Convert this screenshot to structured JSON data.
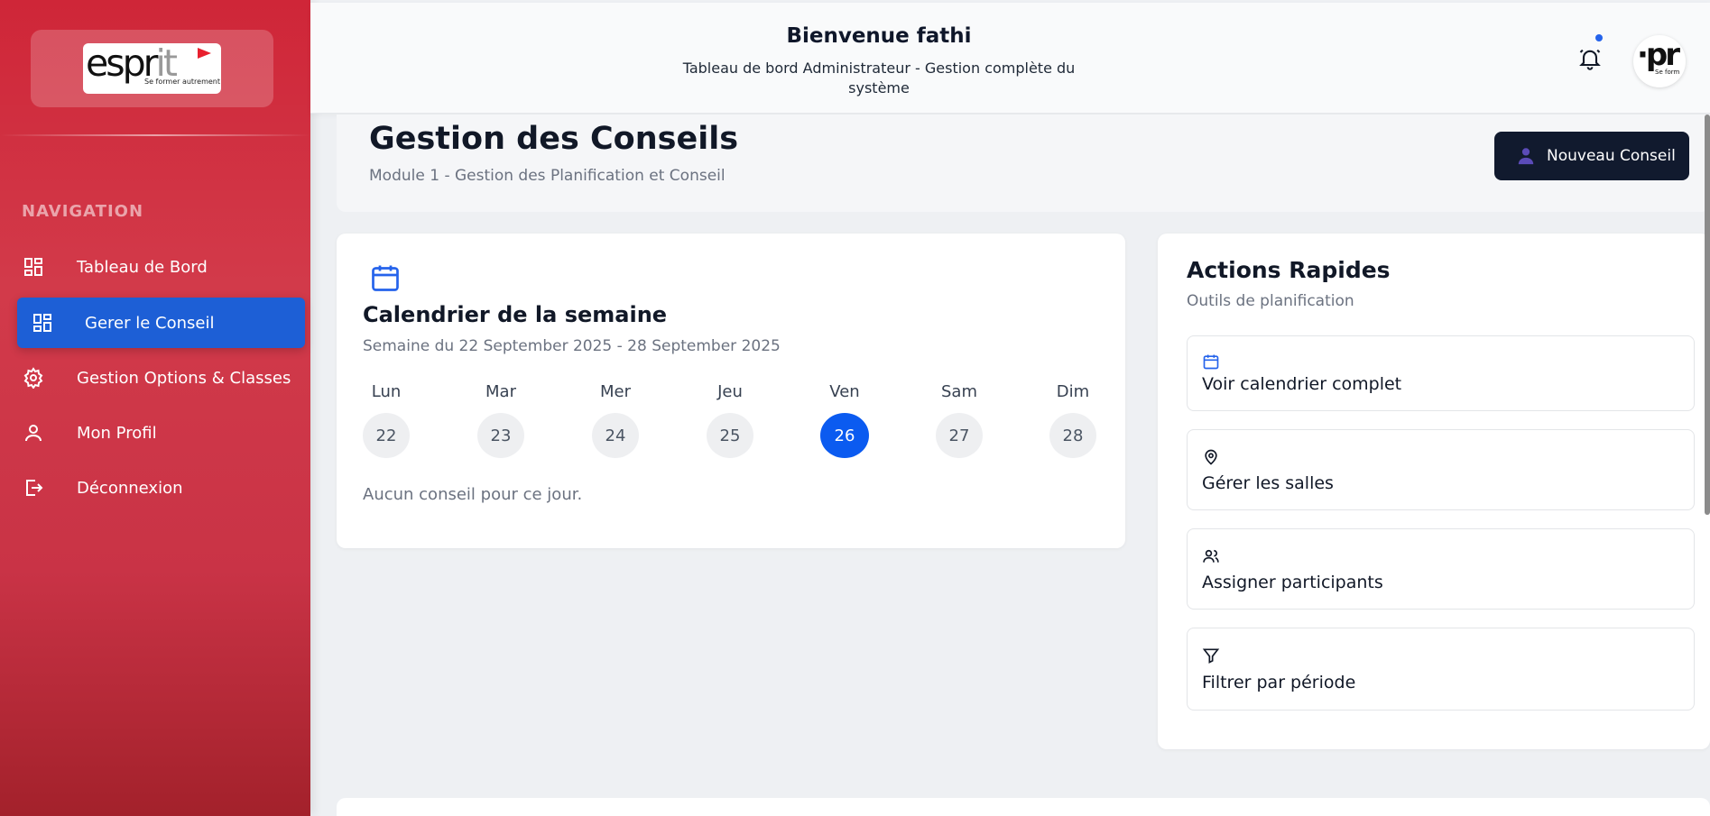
{
  "brand": {
    "logo_word": "esprit",
    "logo_tagline": "Se former autrement",
    "accent": "#cf2638"
  },
  "sidebar": {
    "section_title": "NAVIGATION",
    "items": [
      {
        "label": "Tableau de Bord",
        "icon": "dashboard-icon",
        "active": false
      },
      {
        "label": "Gerer le Conseil",
        "icon": "dashboard-icon",
        "active": true
      },
      {
        "label": "Gestion Options & Classes",
        "icon": "gear-icon",
        "active": false
      },
      {
        "label": "Mon Profil",
        "icon": "user-icon",
        "active": false
      },
      {
        "label": "Déconnexion",
        "icon": "logout-icon",
        "active": false
      }
    ]
  },
  "header": {
    "title": "Bienvenue fathi",
    "subtitle_line1": "Tableau de bord Administrateur - Gestion complète du",
    "subtitle_line2": "système",
    "notification_icon": "bell-icon",
    "has_unread": true
  },
  "page": {
    "title": "Gestion des Conseils",
    "subtitle": "Module 1 - Gestion des Planification et Conseil",
    "new_button_label": "Nouveau Conseil"
  },
  "calendar": {
    "title": "Calendrier de la semaine",
    "range": "Semaine du 22 September 2025 - 28 September 2025",
    "days": [
      {
        "name": "Lun",
        "num": "22",
        "today": false
      },
      {
        "name": "Mar",
        "num": "23",
        "today": false
      },
      {
        "name": "Mer",
        "num": "24",
        "today": false
      },
      {
        "name": "Jeu",
        "num": "25",
        "today": false
      },
      {
        "name": "Ven",
        "num": "26",
        "today": true
      },
      {
        "name": "Sam",
        "num": "27",
        "today": false
      },
      {
        "name": "Dim",
        "num": "28",
        "today": false
      }
    ],
    "empty_message": "Aucun conseil pour ce jour.",
    "accent": "#0b5bf0"
  },
  "quick_actions": {
    "title": "Actions Rapides",
    "subtitle": "Outils de planification",
    "items": [
      {
        "label": "Voir calendrier complet",
        "icon": "calendar-icon"
      },
      {
        "label": "Gérer les salles",
        "icon": "location-pin-icon"
      },
      {
        "label": "Assigner participants",
        "icon": "users-icon"
      },
      {
        "label": "Filtrer par période",
        "icon": "filter-icon"
      }
    ]
  }
}
